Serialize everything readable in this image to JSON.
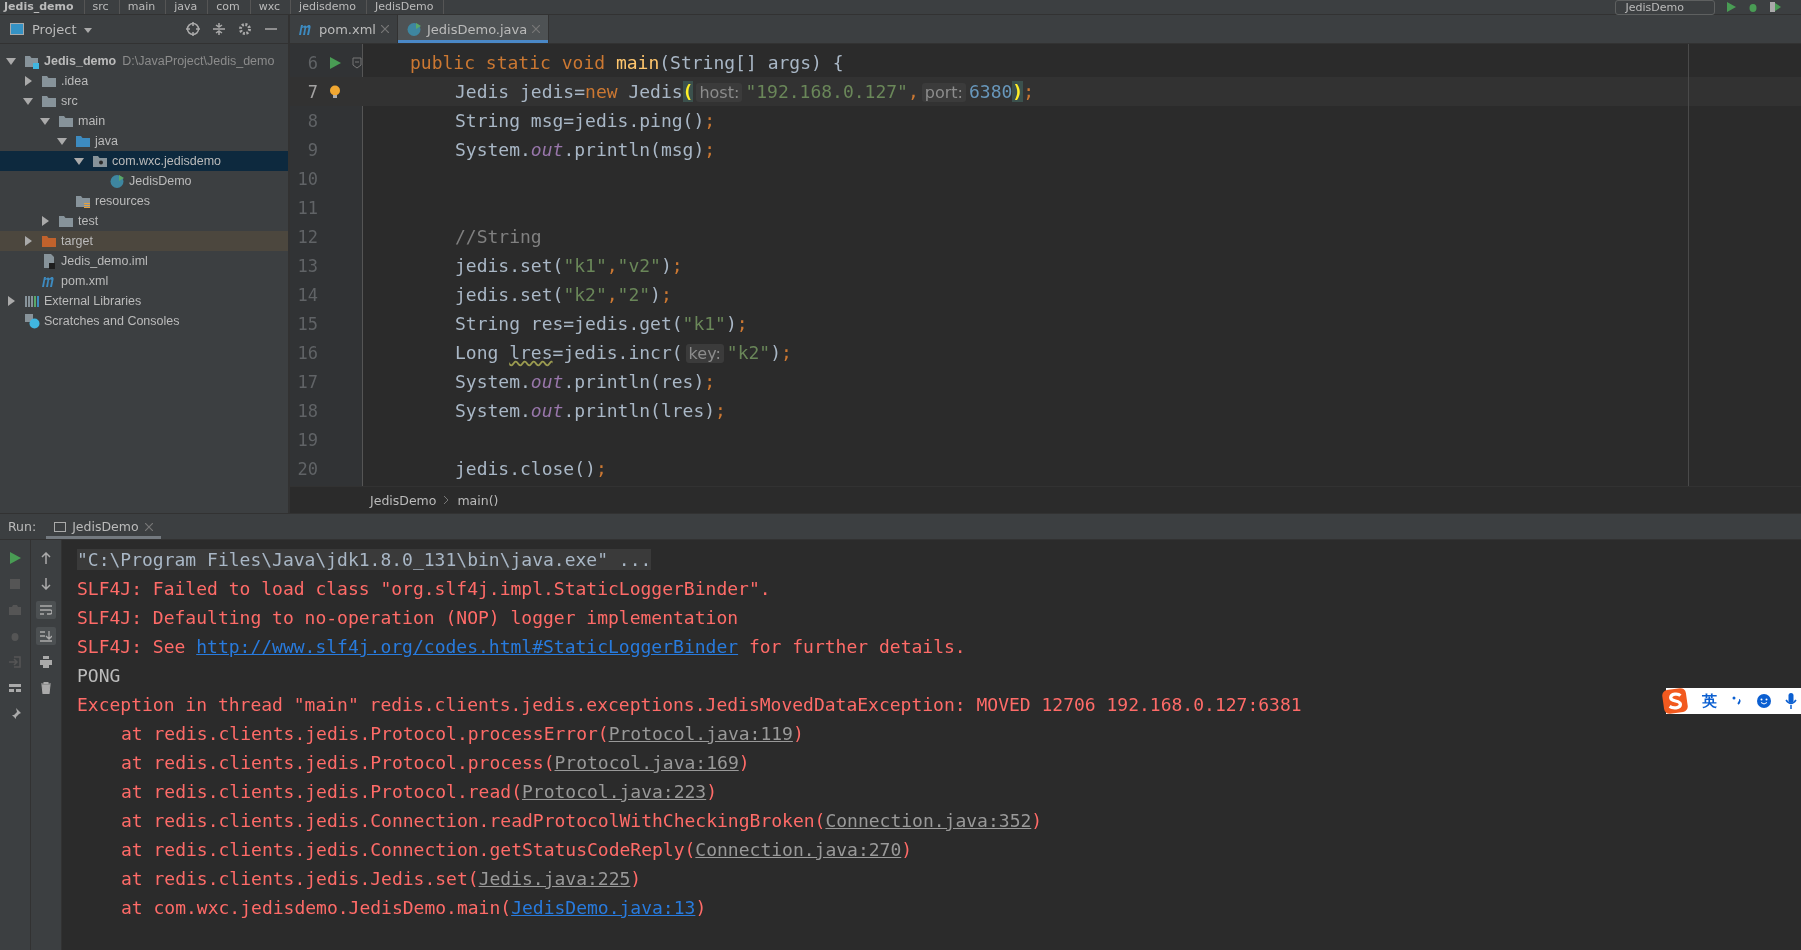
{
  "nav_bar": {
    "crumbs": [
      "Jedis_demo",
      "src",
      "main",
      "java",
      "com",
      "wxc",
      "jedisdemo",
      "JedisDemo"
    ],
    "run_config": "JedisDemo"
  },
  "project_panel": {
    "title": "Project",
    "tree": [
      {
        "label": "Jedis_demo",
        "path": "D:\\JavaProject\\Jedis_demo",
        "kind": "module",
        "expanded": true,
        "selected": false,
        "highlighted": false,
        "children": [
          {
            "label": ".idea",
            "kind": "folder",
            "expanded": false,
            "selected": false,
            "highlighted": false
          },
          {
            "label": "src",
            "kind": "folder",
            "expanded": true,
            "selected": false,
            "highlighted": false,
            "children": [
              {
                "label": "main",
                "kind": "folder",
                "expanded": true,
                "selected": false,
                "highlighted": false,
                "children": [
                  {
                    "label": "java",
                    "kind": "source",
                    "expanded": true,
                    "selected": false,
                    "highlighted": false,
                    "children": [
                      {
                        "label": "com.wxc.jedisdemo",
                        "kind": "package",
                        "expanded": true,
                        "selected": true,
                        "highlighted": false,
                        "children": [
                          {
                            "label": "JedisDemo",
                            "kind": "class",
                            "selected": false,
                            "highlighted": false
                          }
                        ]
                      }
                    ]
                  },
                  {
                    "label": "resources",
                    "kind": "resources",
                    "selected": false,
                    "highlighted": false
                  }
                ]
              },
              {
                "label": "test",
                "kind": "folder",
                "expanded": false,
                "selected": false,
                "highlighted": false
              }
            ]
          },
          {
            "label": "target",
            "kind": "excluded",
            "expanded": false,
            "selected": false,
            "highlighted": true
          },
          {
            "label": "Jedis_demo.iml",
            "kind": "file",
            "selected": false,
            "highlighted": false
          },
          {
            "label": "pom.xml",
            "kind": "maven",
            "selected": false,
            "highlighted": false
          }
        ]
      },
      {
        "label": "External Libraries",
        "kind": "libraries",
        "expanded": false,
        "selected": false,
        "highlighted": false
      },
      {
        "label": "Scratches and Consoles",
        "kind": "scratches",
        "selected": false,
        "highlighted": false
      }
    ]
  },
  "editor_tabs": [
    {
      "label": "pom.xml",
      "kind": "maven",
      "selected": false
    },
    {
      "label": "JedisDemo.java",
      "kind": "class",
      "selected": true
    }
  ],
  "code_lines": [
    {
      "number": "6",
      "kind": "signature",
      "current": false,
      "marker": {
        "kind": "run"
      },
      "tokens": [
        {
          "kind": "keyword",
          "text": "public static void "
        },
        {
          "kind": "method",
          "text": "main"
        },
        {
          "kind": "plain",
          "text": "(String[] args) {"
        }
      ]
    },
    {
      "number": "7",
      "kind": "statement",
      "current": true,
      "marker": {
        "kind": "bulb"
      },
      "tokens": [
        {
          "kind": "plain",
          "text": "Jedis jedis="
        },
        {
          "kind": "keyword",
          "text": "new"
        },
        {
          "kind": "plain",
          "text": " Jedis"
        },
        {
          "kind": "brace",
          "text": "("
        },
        {
          "kind": "hint",
          "text": "host:"
        },
        {
          "kind": "string",
          "text": "\"192.168.0.127\""
        },
        {
          "kind": "keyword",
          "text": ","
        },
        {
          "kind": "hint",
          "text": "port:"
        },
        {
          "kind": "number",
          "text": "6380"
        },
        {
          "kind": "brace",
          "text": ")"
        },
        {
          "kind": "keyword",
          "text": ";"
        }
      ]
    },
    {
      "number": "8",
      "kind": "statement",
      "current": false,
      "tokens": [
        {
          "kind": "plain",
          "text": "String msg=jedis.ping()"
        },
        {
          "kind": "keyword",
          "text": ";"
        }
      ]
    },
    {
      "number": "9",
      "kind": "statement",
      "current": false,
      "tokens": [
        {
          "kind": "plain",
          "text": "System."
        },
        {
          "kind": "static",
          "text": "out"
        },
        {
          "kind": "plain",
          "text": ".println(msg)"
        },
        {
          "kind": "keyword",
          "text": ";"
        }
      ]
    },
    {
      "number": "10",
      "kind": "blank",
      "current": false
    },
    {
      "number": "11",
      "kind": "blank",
      "current": false
    },
    {
      "number": "12",
      "kind": "statement",
      "current": false,
      "tokens": [
        {
          "kind": "comment",
          "text": "//String"
        }
      ]
    },
    {
      "number": "13",
      "kind": "statement",
      "current": false,
      "tokens": [
        {
          "kind": "plain",
          "text": "jedis.set("
        },
        {
          "kind": "string",
          "text": "\"k1\""
        },
        {
          "kind": "keyword",
          "text": ","
        },
        {
          "kind": "string",
          "text": "\"v2\""
        },
        {
          "kind": "plain",
          "text": ")"
        },
        {
          "kind": "keyword",
          "text": ";"
        }
      ]
    },
    {
      "number": "14",
      "kind": "statement",
      "current": false,
      "tokens": [
        {
          "kind": "plain",
          "text": "jedis.set("
        },
        {
          "kind": "string",
          "text": "\"k2\""
        },
        {
          "kind": "keyword",
          "text": ","
        },
        {
          "kind": "string",
          "text": "\"2\""
        },
        {
          "kind": "plain",
          "text": ")"
        },
        {
          "kind": "keyword",
          "text": ";"
        }
      ]
    },
    {
      "number": "15",
      "kind": "statement",
      "current": false,
      "tokens": [
        {
          "kind": "plain",
          "text": "String res=jedis.get("
        },
        {
          "kind": "string",
          "text": "\"k1\""
        },
        {
          "kind": "plain",
          "text": ")"
        },
        {
          "kind": "keyword",
          "text": ";"
        }
      ]
    },
    {
      "number": "16",
      "kind": "statement",
      "current": false,
      "tokens": [
        {
          "kind": "plain",
          "text": "Long "
        },
        {
          "kind": "warning",
          "text": "lres"
        },
        {
          "kind": "plain",
          "text": "=jedis.incr("
        },
        {
          "kind": "hint",
          "text": "key:"
        },
        {
          "kind": "string",
          "text": "\"k2\""
        },
        {
          "kind": "plain",
          "text": ")"
        },
        {
          "kind": "keyword",
          "text": ";"
        }
      ]
    },
    {
      "number": "17",
      "kind": "statement",
      "current": false,
      "tokens": [
        {
          "kind": "plain",
          "text": "System."
        },
        {
          "kind": "static",
          "text": "out"
        },
        {
          "kind": "plain",
          "text": ".println(res)"
        },
        {
          "kind": "keyword",
          "text": ";"
        }
      ]
    },
    {
      "number": "18",
      "kind": "statement",
      "current": false,
      "tokens": [
        {
          "kind": "plain",
          "text": "System."
        },
        {
          "kind": "static",
          "text": "out"
        },
        {
          "kind": "plain",
          "text": ".println(lres)"
        },
        {
          "kind": "keyword",
          "text": ";"
        }
      ]
    },
    {
      "number": "19",
      "kind": "blank",
      "current": false
    },
    {
      "number": "20",
      "kind": "statement",
      "current": false,
      "tokens": [
        {
          "kind": "plain",
          "text": "jedis.close()"
        },
        {
          "kind": "keyword",
          "text": ";"
        }
      ]
    }
  ],
  "editor_breadcrumb": [
    "JedisDemo",
    "main()"
  ],
  "run_panel": {
    "label": "Run:",
    "tab": "JedisDemo",
    "console": [
      {
        "kind": "command",
        "parts": [
          {
            "kind": "text",
            "text": "\"C:\\Program Files\\Java\\jdk1.8.0_131\\bin\\java.exe\" ..."
          }
        ]
      },
      {
        "kind": "error",
        "parts": [
          {
            "kind": "text",
            "text": "SLF4J: Failed to load class \"org.slf4j.impl.StaticLoggerBinder\"."
          }
        ]
      },
      {
        "kind": "error",
        "parts": [
          {
            "kind": "text",
            "text": "SLF4J: Defaulting to no-operation (NOP) logger implementation"
          }
        ]
      },
      {
        "kind": "error",
        "parts": [
          {
            "kind": "text",
            "text": "SLF4J: See "
          },
          {
            "kind": "link",
            "text": "http://www.slf4j.org/codes.html#StaticLoggerBinder"
          },
          {
            "kind": "text",
            "text": " for further details."
          }
        ]
      },
      {
        "kind": "output",
        "parts": [
          {
            "kind": "text",
            "text": "PONG"
          }
        ]
      },
      {
        "kind": "error",
        "parts": [
          {
            "kind": "text",
            "text": "Exception in thread \"main\" redis.clients.jedis.exceptions.JedisMovedDataException: MOVED 12706 192.168.0.127:6381"
          }
        ]
      },
      {
        "kind": "trace",
        "parts": [
          {
            "kind": "text",
            "text": "at redis.clients.jedis.Protocol.processError("
          },
          {
            "kind": "file-link",
            "text": "Protocol.java:119"
          },
          {
            "kind": "text",
            "text": ")"
          }
        ]
      },
      {
        "kind": "trace",
        "parts": [
          {
            "kind": "text",
            "text": "at redis.clients.jedis.Protocol.process("
          },
          {
            "kind": "file-link",
            "text": "Protocol.java:169"
          },
          {
            "kind": "text",
            "text": ")"
          }
        ]
      },
      {
        "kind": "trace",
        "parts": [
          {
            "kind": "text",
            "text": "at redis.clients.jedis.Protocol.read("
          },
          {
            "kind": "file-link",
            "text": "Protocol.java:223"
          },
          {
            "kind": "text",
            "text": ")"
          }
        ]
      },
      {
        "kind": "trace",
        "parts": [
          {
            "kind": "text",
            "text": "at redis.clients.jedis.Connection.readProtocolWithCheckingBroken("
          },
          {
            "kind": "file-link",
            "text": "Connection.java:352"
          },
          {
            "kind": "text",
            "text": ")"
          }
        ]
      },
      {
        "kind": "trace",
        "parts": [
          {
            "kind": "text",
            "text": "at redis.clients.jedis.Connection.getStatusCodeReply("
          },
          {
            "kind": "file-link",
            "text": "Connection.java:270"
          },
          {
            "kind": "text",
            "text": ")"
          }
        ]
      },
      {
        "kind": "trace",
        "parts": [
          {
            "kind": "text",
            "text": "at redis.clients.jedis.Jedis.set("
          },
          {
            "kind": "file-link",
            "text": "Jedis.java:225"
          },
          {
            "kind": "text",
            "text": ")"
          }
        ]
      },
      {
        "kind": "trace",
        "parts": [
          {
            "kind": "text",
            "text": "at com.wxc.jedisdemo.JedisDemo.main("
          },
          {
            "kind": "link",
            "text": "JedisDemo.java:13"
          },
          {
            "kind": "text",
            "text": ")"
          }
        ]
      }
    ]
  },
  "ime_toolbar": {
    "label": "英"
  }
}
